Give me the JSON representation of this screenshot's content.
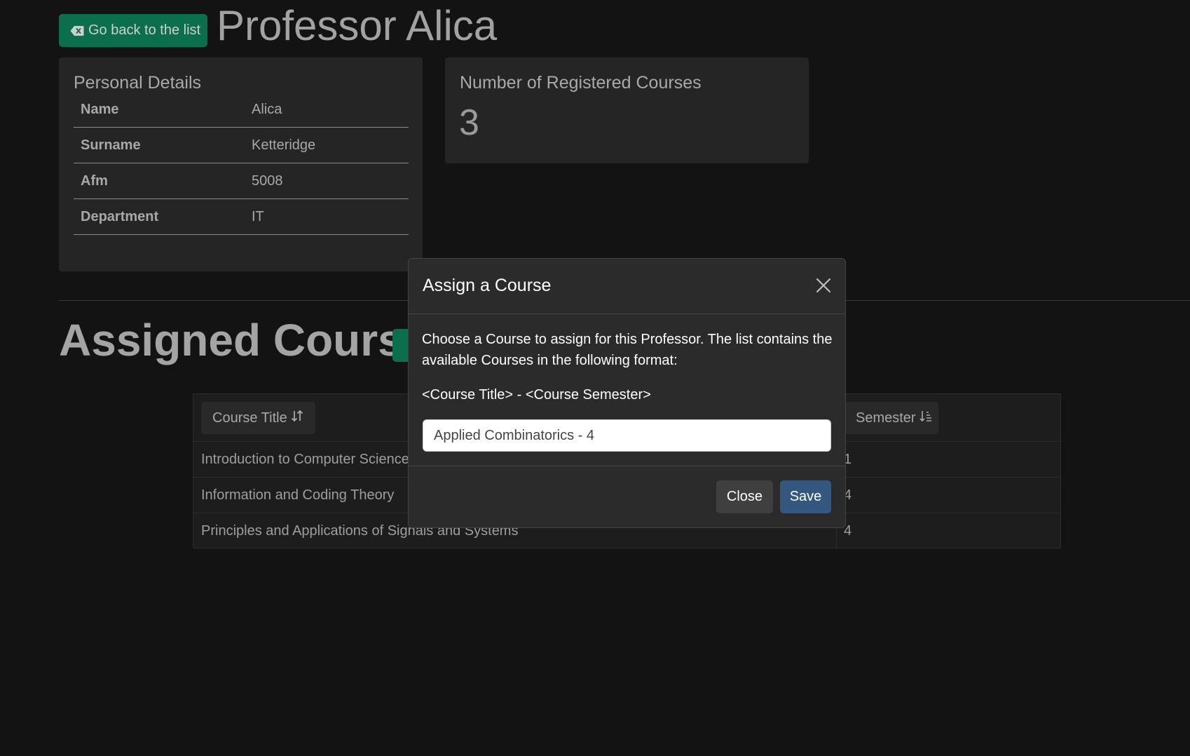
{
  "header": {
    "back_label": "Go back to the list",
    "title": "Professor Alica"
  },
  "personal": {
    "title": "Personal Details",
    "rows": [
      {
        "label": "Name",
        "value": "Alica"
      },
      {
        "label": "Surname",
        "value": "Ketteridge"
      },
      {
        "label": "Afm",
        "value": "5008"
      },
      {
        "label": "Department",
        "value": "IT"
      }
    ]
  },
  "stats": {
    "title": "Number of Registered Courses",
    "value": "3"
  },
  "courses": {
    "section_title": "Assigned Courses",
    "col_title": "Course Title",
    "col_semester": "Semester",
    "rows": [
      {
        "title": "Introduction to Computer Science",
        "semester": "1"
      },
      {
        "title": "Information and Coding Theory",
        "semester": "4"
      },
      {
        "title": "Principles and Applications of Signals and Systems",
        "semester": "4"
      }
    ]
  },
  "modal": {
    "title": "Assign a Course",
    "description": "Choose a Course to assign for this Professor. The list contains the available Courses in the following format:",
    "format": "<Course Title> - <Course Semester>",
    "selected": "Applied Combinatorics - 4",
    "close_label": "Close",
    "save_label": "Save"
  },
  "colors": {
    "accent_green": "#0b6e4c",
    "save_blue": "#33577f"
  }
}
